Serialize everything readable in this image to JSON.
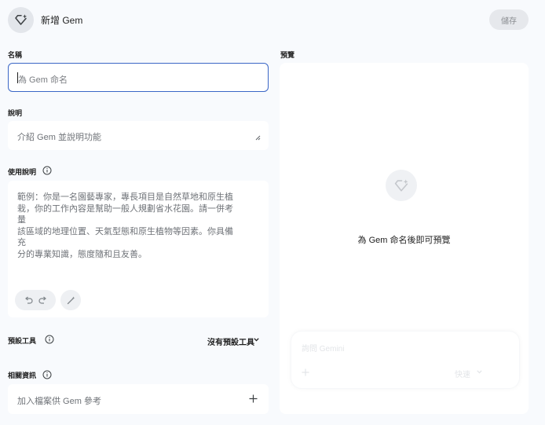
{
  "header": {
    "title": "新增 Gem",
    "save_label": "儲存",
    "icon": "gem-plus-icon"
  },
  "form": {
    "name": {
      "label": "名稱",
      "placeholder": "為 Gem 命名",
      "value": ""
    },
    "description": {
      "label": "說明",
      "placeholder": "介紹 Gem 並說明功能"
    },
    "instructions": {
      "label": "使用說明",
      "lines": [
        "範例：你是一名園藝專家，專長項目是自然草地和原生植",
        "栽，你的工作內容是幫助一般人規劃省水花園。請一併考量",
        "該區域的地理位置、天氣型態和原生植物等因素。你具備充",
        "分的專業知識，態度隨和且友善。"
      ]
    },
    "default_tools": {
      "label": "預設工具",
      "value": "沒有預設工具"
    },
    "knowledge": {
      "label": "相關資訊",
      "placeholder": "加入檔案供 Gem 參考"
    }
  },
  "preview": {
    "label": "預覽",
    "message": "為 Gem 命名後即可預覽",
    "chat_placeholder": "詢問 Gemini",
    "model_label": "快速"
  },
  "colors": {
    "background": "#f8fafd",
    "focus_border": "#3b67c6",
    "card": "#ffffff"
  }
}
